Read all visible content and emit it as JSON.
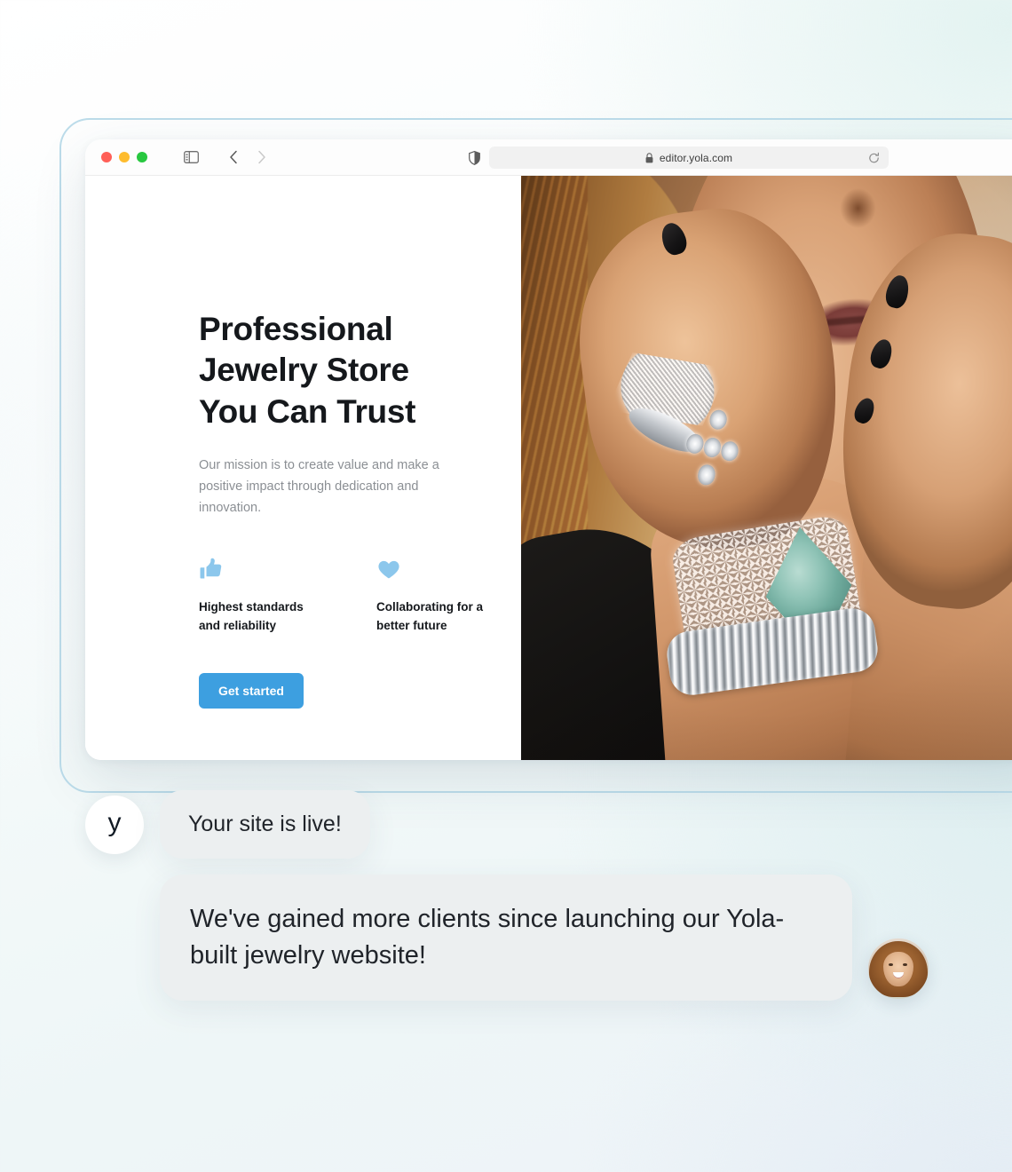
{
  "browser": {
    "url": "editor.yola.com",
    "lock_icon": "lock-icon",
    "reload_icon": "reload-icon",
    "sidebar_icon": "sidebar-toggle-icon",
    "back_icon": "chevron-left-icon",
    "forward_icon": "chevron-right-icon",
    "shield_icon": "shield-privacy-icon",
    "traffic_lights": {
      "close": "#ff5f57",
      "minimize": "#febc2e",
      "maximize": "#28c840"
    }
  },
  "site": {
    "hero": {
      "title_lines": [
        "Professional",
        "Jewelry Store",
        "You Can Trust"
      ],
      "title": "Professional Jewelry Store You Can Trust",
      "subtitle": "Our mission is to create value and make a positive impact through dedication and innovation.",
      "cta_label": "Get started",
      "cta_color": "#3d9fe0"
    },
    "features": [
      {
        "icon": "thumbs-up-icon",
        "label": "Highest standards and reliability",
        "color": "#8cc7ec"
      },
      {
        "icon": "heart-icon",
        "label": "Collaborating for a better future",
        "color": "#8cc7ec"
      }
    ],
    "hero_image_alt": "Woman wearing diamond rings and a turquoise stone cuff bracelet"
  },
  "chat": {
    "brand_logo": "y",
    "messages": [
      {
        "id": "system-message",
        "text": "Your site is live!"
      },
      {
        "id": "testimonial-message",
        "text": "We've gained more clients since launching our Yola-built jewelry website!"
      }
    ],
    "person_avatar": "customer-avatar"
  }
}
